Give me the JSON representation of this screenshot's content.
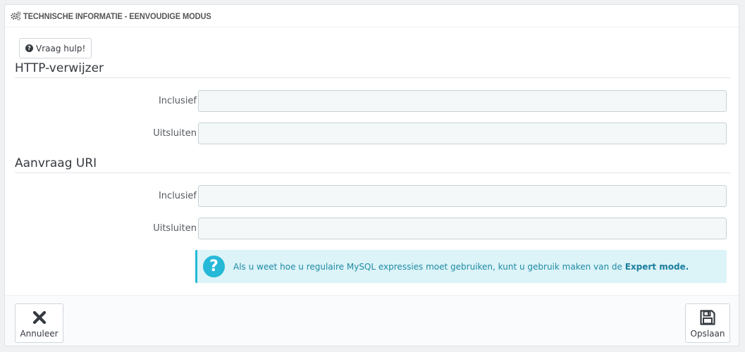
{
  "panel": {
    "title": "TECHNISCHE INFORMATIE - EENVOUDIGE MODUS",
    "title_icon": "cogs-icon"
  },
  "help_button": {
    "label": "Vraag hulp!",
    "icon": "question-circle-icon"
  },
  "sections": [
    {
      "title": "HTTP-verwijzer",
      "fields": [
        {
          "label": "Inclusief",
          "value": ""
        },
        {
          "label": "Uitsluiten",
          "value": ""
        }
      ]
    },
    {
      "title": "Aanvraag URI",
      "fields": [
        {
          "label": "Inclusief",
          "value": ""
        },
        {
          "label": "Uitsluiten",
          "value": ""
        }
      ]
    }
  ],
  "info_alert": {
    "icon": "question-icon",
    "text": "Als u weet hoe u regulaire MySQL expressies moet gebruiken, kunt u gebruik maken van de ",
    "link": "Expert mode."
  },
  "footer": {
    "cancel_label": "Annuleer",
    "cancel_icon": "close-icon",
    "save_label": "Opslaan",
    "save_icon": "floppy-disk-icon"
  },
  "colors": {
    "accent": "#25b9d7",
    "alert_bg": "#dcf3f8",
    "text": "#363a41"
  }
}
